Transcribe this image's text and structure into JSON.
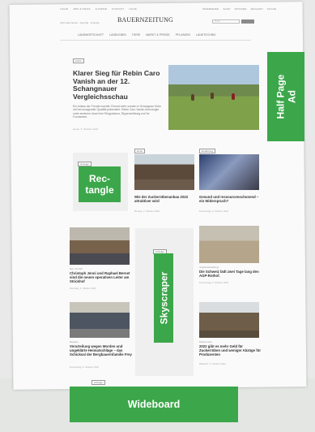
{
  "header": {
    "top_links_left": [
      "LOGIN",
      "ABO & INFOS",
      "E-PAPER",
      "KONTAKT",
      "HILFE"
    ],
    "top_links_right": [
      "INSERIEREN",
      "SHOP",
      "DOSSIER",
      "MAGAZIN",
      "SUCHE"
    ],
    "logo": "BAUERNZEITUNG",
    "sub_info": "Jetzt abonnieren · Agenda · Inserate",
    "search_placeholder": "Suche"
  },
  "main_nav": [
    "LANDWIRTSCHAFT",
    "LANDLEBEN",
    "TIERE",
    "MARKT & PREISE",
    "PFLANZEN",
    "LANDTECHNIK"
  ],
  "hero": {
    "badge": "Zucht",
    "title": "Klarer Sieg für Rebin Caro Vanish an der 12. Schangnauer Vergleichsschau",
    "text": "Ein Anlass der Freude machte: Einmal mehr wurden in Schangnau Kühe mit hervorragender Qualität präsentiert. Rebin Caro Vanish überzeugte unter anderem durch ihre Ringpräsenz, Rippenwölbung und ihr Fundament.",
    "meta": "Heute, 6. Oktober 2022"
  },
  "ads": {
    "half_page": "Half Page\nAd",
    "rectangle": "Rec-\ntangle",
    "rectangle_badge": "Anzeige",
    "skyscraper": "Skyscraper",
    "skyscraper_badge": "Anzeige",
    "wideboard": "Wideboard",
    "wideboard_badge": "Anzeige"
  },
  "cards": [
    {
      "badge": "Ernte",
      "title": "Wie der Zuckerrübenanbau 2022 attraktiver wird",
      "meta": "Montag, 3. Oktober 2022"
    },
    {
      "badge": "Ernährung",
      "title": "Gesund und ressourcenschonend – ein Widerspruch?",
      "meta": "Donnerstag, 6. Oktober 2022"
    },
    {
      "kicker": "Neu: Portrait",
      "title": "Christoph Jenni und Raphael Bernet sind die neuen operativen Leiter am Strickhof",
      "meta": "Dienstag, 4. Oktober 2022"
    },
    {
      "kicker": "Jungtierausstellung",
      "title": "Die Schweiz lädt zwei Tage lang den AGP-Rothof.",
      "meta": "Donnerstag, 6. Oktober 2022"
    },
    {
      "kicker": "Bergbau",
      "title": "Verurteilung wegen Morden und ungeklärte Heimatschläge – das Schicksal der Bergbauernfamilie Frey",
      "meta": "Donnerstag, 6. Oktober 2022"
    },
    {
      "kicker": "Rübenpreise",
      "title": "2022 gibt es mehr Geld für Zuckerrüben und weniger Abzüge für Produzenten",
      "meta": "Mittwoch, 5. Oktober 2022"
    }
  ],
  "colors": {
    "ad_green": "#3ca74a",
    "page_background": "#fafafa",
    "band_background": "#e3e6e3"
  }
}
